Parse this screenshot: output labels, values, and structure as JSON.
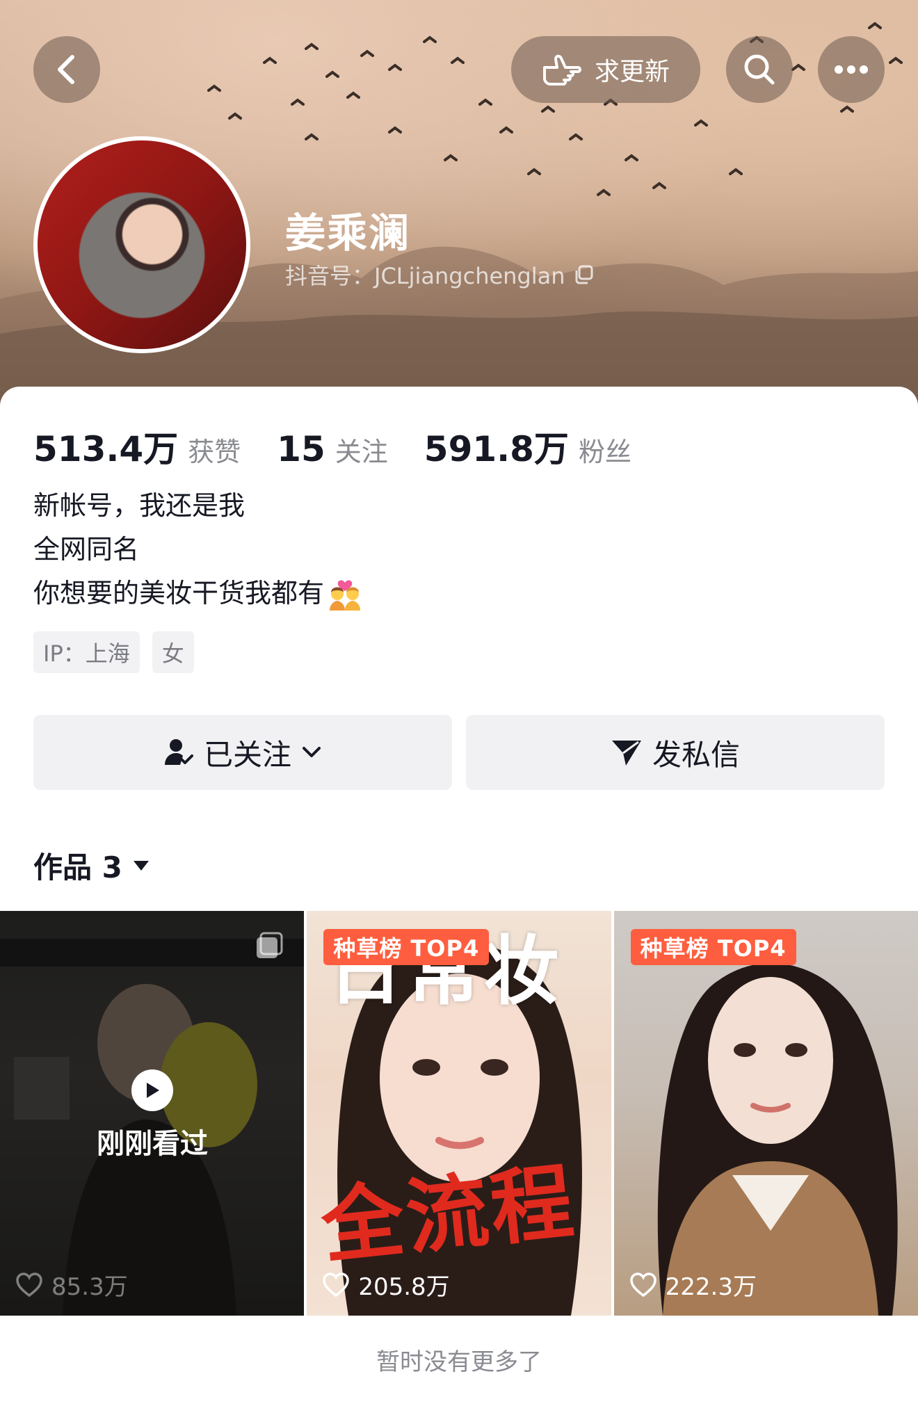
{
  "header": {
    "back_icon": "chevron-left-icon",
    "request_update_label": "求更新",
    "request_update_icon": "pointing-hand-icon",
    "search_icon": "search-icon",
    "more_icon": "ellipsis-icon"
  },
  "profile": {
    "name": "姜乘澜",
    "handle": "抖音号：JCLjiangchenglan",
    "stats": [
      {
        "value": "513.4万",
        "label": "获赞"
      },
      {
        "value": "15",
        "label": "关注"
      },
      {
        "value": "591.8万",
        "label": "粉丝"
      }
    ],
    "bio": [
      "新帐号，我还是我",
      "全网同名",
      "你想要的美妆干货我都有"
    ],
    "tags": [
      "IP：上海",
      "女"
    ]
  },
  "actions": {
    "follow_label": "已关注",
    "message_label": "发私信"
  },
  "works": {
    "tab_label": "作品 3",
    "items": [
      {
        "likes": "85.3万",
        "status": "刚刚看过",
        "badge": ""
      },
      {
        "likes": "205.8万",
        "status": "",
        "badge": "种草榜 TOP4",
        "overlay_text": [
          "日常妆",
          "全流程"
        ]
      },
      {
        "likes": "222.3万",
        "status": "",
        "badge": "种草榜 TOP4"
      }
    ]
  },
  "footer": {
    "note": "暂时没有更多了"
  },
  "colors": {
    "accent": "#fe5e3f",
    "text": "#161823",
    "muted": "#8a8b91",
    "button_bg": "#f1f1f3"
  }
}
